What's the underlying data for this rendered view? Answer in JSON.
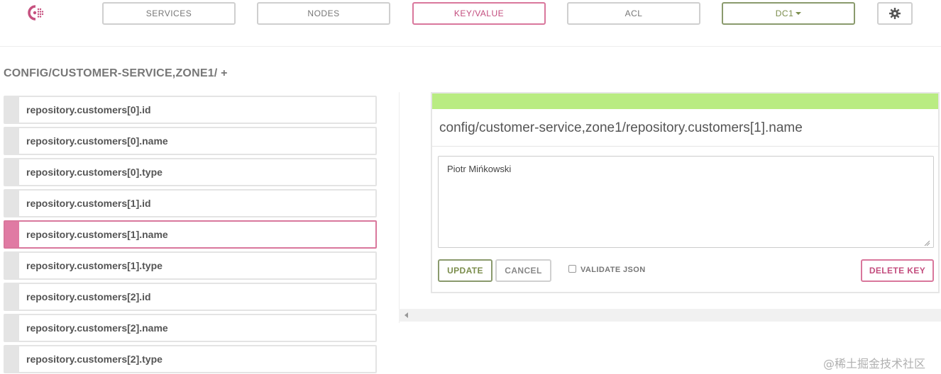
{
  "nav": {
    "services": "SERVICES",
    "nodes": "NODES",
    "keyvalue": "KEY/VALUE",
    "acl": "ACL",
    "datacenter": "DC1"
  },
  "icons": {
    "logo": "consul-logo-icon",
    "settings": "gear-icon",
    "dropdown": "caret-down-icon"
  },
  "colors": {
    "accent_pink": "#d9779c",
    "accent_green": "#b9ec82",
    "accent_olive": "#7b8d4c"
  },
  "breadcrumb": {
    "path": "CONFIG/CUSTOMER-SERVICE,ZONE1/ +"
  },
  "keys": [
    {
      "label": "repository.customers[0].id",
      "selected": false
    },
    {
      "label": "repository.customers[0].name",
      "selected": false
    },
    {
      "label": "repository.customers[0].type",
      "selected": false
    },
    {
      "label": "repository.customers[1].id",
      "selected": false
    },
    {
      "label": "repository.customers[1].name",
      "selected": true
    },
    {
      "label": "repository.customers[1].type",
      "selected": false
    },
    {
      "label": "repository.customers[2].id",
      "selected": false
    },
    {
      "label": "repository.customers[2].name",
      "selected": false
    },
    {
      "label": "repository.customers[2].type",
      "selected": false
    }
  ],
  "editor": {
    "key_path": "config/customer-service,zone1/repository.customers[1].name",
    "value": "Piotr Mińkowski",
    "update_label": "UPDATE",
    "cancel_label": "CANCEL",
    "validate_json_label": "VALIDATE JSON",
    "validate_json_checked": false,
    "delete_label": "DELETE KEY"
  },
  "watermark": "@稀土掘金技术社区"
}
